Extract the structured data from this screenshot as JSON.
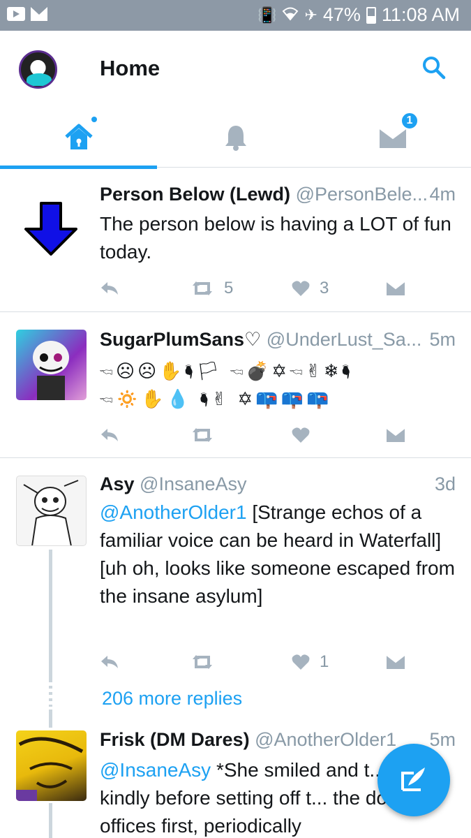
{
  "status_bar": {
    "battery": "47%",
    "time": "11:08 AM",
    "icons": [
      "youtube-icon",
      "mail-icon",
      "vibrate-icon",
      "wifi-icon",
      "airplane-icon",
      "battery-icon"
    ]
  },
  "header": {
    "title": "Home"
  },
  "tabs": {
    "messages_badge": "1",
    "active": "home"
  },
  "tweets": [
    {
      "name": "Person Below (Lewd)",
      "handle": "@PersonBele...",
      "time": "4m",
      "text": "The person below is having a LOT of fun today.",
      "retweets": "5",
      "likes": "3"
    },
    {
      "name": "SugarPlumSans♡",
      "handle": "@UnderLust_Sa...",
      "time": "5m",
      "emoji_line1": "🖘☹☹✋🖣🏳 🖘💣✡🖘✌❄🖣",
      "emoji_line2": "🖘🔅✋💧 🖣✌ ✡📪📪📪"
    },
    {
      "name": "Asy",
      "handle": "@InsaneAsy",
      "time": "3d",
      "mention": "@AnotherOlder1",
      "text_line1": " [Strange echos of a familiar voice can be heard in Waterfall]",
      "text_line2": "[uh oh, looks like someone escaped from the insane asylum]",
      "likes": "1",
      "more_replies": "206 more replies"
    },
    {
      "name": "Frisk (DM Dares)",
      "handle": "@AnotherOlder1",
      "time": "5m",
      "mention": "@InsaneAsy",
      "text": " *She smiled and t... them kindly before setting off t... the doctor's offices first, periodically"
    }
  ],
  "colors": {
    "accent": "#1da1f2",
    "status_bar": "#8d99a6",
    "muted": "#8899a6"
  }
}
